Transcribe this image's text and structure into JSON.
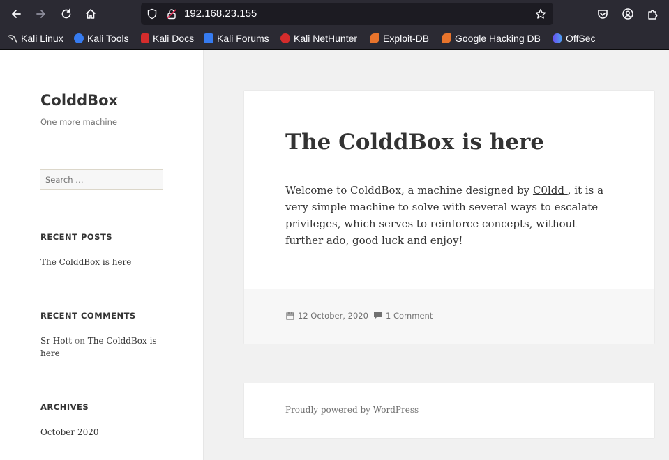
{
  "browser": {
    "url": "192.168.23.155",
    "bookmarks": [
      {
        "label": "Kali Linux",
        "icon": "kali-dragon-icon",
        "color": "#dddddd"
      },
      {
        "label": "Kali Tools",
        "icon": "kali-tools-icon",
        "color": "#367bf0"
      },
      {
        "label": "Kali Docs",
        "icon": "kali-docs-icon",
        "color": "#d42c2c"
      },
      {
        "label": "Kali Forums",
        "icon": "kali-forums-icon",
        "color": "#367bf0"
      },
      {
        "label": "Kali NetHunter",
        "icon": "kali-nethunter-icon",
        "color": "#d42c2c"
      },
      {
        "label": "Exploit-DB",
        "icon": "exploit-db-icon",
        "color": "#e8742c"
      },
      {
        "label": "Google Hacking DB",
        "icon": "ghdb-icon",
        "color": "#e8742c"
      },
      {
        "label": "OffSec",
        "icon": "offsec-icon",
        "color": "#6a4cf0"
      }
    ]
  },
  "sidebar": {
    "site_title": "ColddBox",
    "site_description": "One more machine",
    "search_placeholder": "Search …",
    "recent_posts_title": "RECENT POSTS",
    "recent_post": "The ColddBox is here",
    "recent_comments_title": "RECENT COMMENTS",
    "comment_author": "Sr Hott",
    "comment_on": "on",
    "comment_post_line1": "The ColddBox is",
    "comment_post_line2": "here",
    "archives_title": "ARCHIVES",
    "archive_item": "October 2020"
  },
  "post": {
    "title": "The ColddBox is here",
    "content_before": "Welcome to ColddBox, a machine designed by ",
    "author_link": "C0ldd ",
    "content_after": ", it is a very simple machine to solve with several ways to escalate privileges, which serves to reinforce concepts, without further ado, good luck and enjoy!",
    "date": "12 October, 2020",
    "comments": "1 Comment"
  },
  "footer": {
    "powered_by": "Proudly powered by WordPress"
  },
  "colors": {
    "toolbar_bg": "#2b2a33",
    "page_bg": "#f1f1f1",
    "text": "#333333",
    "meta": "#707070"
  }
}
